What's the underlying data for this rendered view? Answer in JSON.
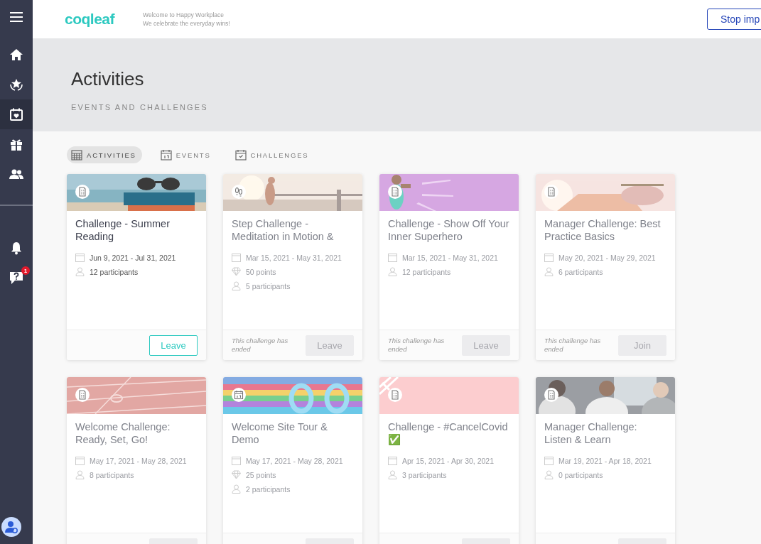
{
  "sidebar": {
    "top_items": [
      {
        "kind": "home",
        "selected": false
      },
      {
        "kind": "awards",
        "selected": false
      },
      {
        "kind": "calendar",
        "selected": true
      },
      {
        "kind": "gift",
        "selected": false
      },
      {
        "kind": "people",
        "selected": false
      }
    ],
    "bottom_items": [
      {
        "kind": "bell",
        "selected": false
      },
      {
        "kind": "help",
        "selected": false,
        "badge": "1"
      }
    ]
  },
  "header": {
    "logo": "coqleaf",
    "tagline": [
      "Welcome to Happy Workplace",
      "We celebrate the everyday wins!"
    ],
    "button": "Stop imp"
  },
  "page": {
    "title": "Activities",
    "subtitle": "EVENTS AND CHALLENGES"
  },
  "tabs": [
    {
      "label": "ACTIVITIES",
      "kind": "grid",
      "selected": true
    },
    {
      "label": "EVENTS",
      "kind": "event",
      "selected": false
    },
    {
      "label": "CHALLENGES",
      "kind": "check",
      "selected": false
    }
  ],
  "cards": [
    {
      "kind": "doc",
      "title": "Challenge - Summer Reading",
      "dates": "Jun 9, 2021 - Jul 31, 2021",
      "participants": "12 participants",
      "ended": false,
      "button": {
        "label": "Leave",
        "disabled": false
      }
    },
    {
      "kind": "steps",
      "title": "Step Challenge - Meditation in Motion &",
      "dates": "Mar 15, 2021 - May 31, 2021",
      "points": "50 points",
      "participants": "5 participants",
      "ended": true,
      "note": "This challenge has ended",
      "button": {
        "label": "Leave",
        "disabled": true
      }
    },
    {
      "kind": "doc",
      "title": "Challenge - Show Off Your Inner Superhero",
      "dates": "Mar 15, 2021 - May 31, 2021",
      "participants": "12 participants",
      "ended": true,
      "note": "This challenge has ended",
      "button": {
        "label": "Leave",
        "disabled": true
      }
    },
    {
      "kind": "doc",
      "title": "Manager Challenge: Best Practice Basics",
      "dates": "May 20, 2021 - May 29, 2021",
      "participants": "6 participants",
      "ended": true,
      "note": "This challenge has ended",
      "button": {
        "label": "Join",
        "disabled": true
      }
    },
    {
      "kind": "doc",
      "title": "Welcome Challenge: Ready, Set, Go!",
      "dates": "May 17, 2021 - May 28, 2021",
      "participants": "8 participants",
      "ended": true,
      "button": {
        "disabled": true
      }
    },
    {
      "kind": "event",
      "title": "Welcome Site Tour & Demo",
      "dates": "May 17, 2021 - May 28, 2021",
      "points": "25 points",
      "participants": "2 participants",
      "ended": true,
      "button": {
        "disabled": true
      }
    },
    {
      "kind": "doc",
      "title": "Challenge - #CancelCovid ✅",
      "dates": "Apr 15, 2021 - Apr 30, 2021",
      "participants": "3 participants",
      "ended": true,
      "button": {
        "disabled": true
      }
    },
    {
      "kind": "doc",
      "title": "Manager Challenge: Listen & Learn",
      "dates": "Mar 19, 2021 - Apr 18, 2021",
      "participants": "0 participants",
      "ended": true,
      "button": {
        "disabled": true
      }
    }
  ]
}
